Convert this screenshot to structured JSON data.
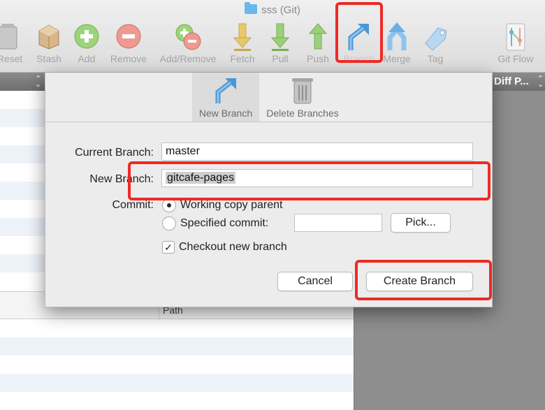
{
  "window": {
    "title": "sss (Git)"
  },
  "toolbar": {
    "items": [
      {
        "label": "Reset",
        "icon": "reset-icon"
      },
      {
        "label": "Stash",
        "icon": "stash-icon"
      },
      {
        "label": "Add",
        "icon": "add-icon"
      },
      {
        "label": "Remove",
        "icon": "remove-icon"
      },
      {
        "label": "Add/Remove",
        "icon": "add-remove-icon"
      },
      {
        "label": "Fetch",
        "icon": "fetch-icon"
      },
      {
        "label": "Pull",
        "icon": "pull-icon"
      },
      {
        "label": "Push",
        "icon": "push-icon"
      },
      {
        "label": "Branch",
        "icon": "branch-icon"
      },
      {
        "label": "Merge",
        "icon": "merge-icon"
      },
      {
        "label": "Tag",
        "icon": "tag-icon"
      },
      {
        "label": "Git Flow",
        "icon": "git-flow-icon"
      }
    ]
  },
  "background": {
    "diff_header": "Diff P...",
    "path_header": "Path"
  },
  "sheet": {
    "tabs": [
      {
        "label": "New Branch",
        "active": true,
        "icon": "new-branch-icon"
      },
      {
        "label": "Delete Branches",
        "active": false,
        "icon": "trash-icon"
      }
    ],
    "current_branch": {
      "label": "Current Branch:",
      "value": "master"
    },
    "new_branch": {
      "label": "New Branch:",
      "value": "gitcafe-pages"
    },
    "commit": {
      "label": "Commit:",
      "options": [
        {
          "label": "Working copy parent",
          "selected": true
        },
        {
          "label": "Specified commit:",
          "selected": false
        }
      ],
      "specified_value": "",
      "pick_label": "Pick..."
    },
    "checkout": {
      "label": "Checkout new branch",
      "checked": true
    },
    "cancel_label": "Cancel",
    "create_label": "Create Branch"
  },
  "colors": {
    "highlight": "#ee2a24",
    "push_green": "#9ccf7a",
    "fetch_yellow": "#e8c96a",
    "branch_blue": "#4a97d6"
  }
}
